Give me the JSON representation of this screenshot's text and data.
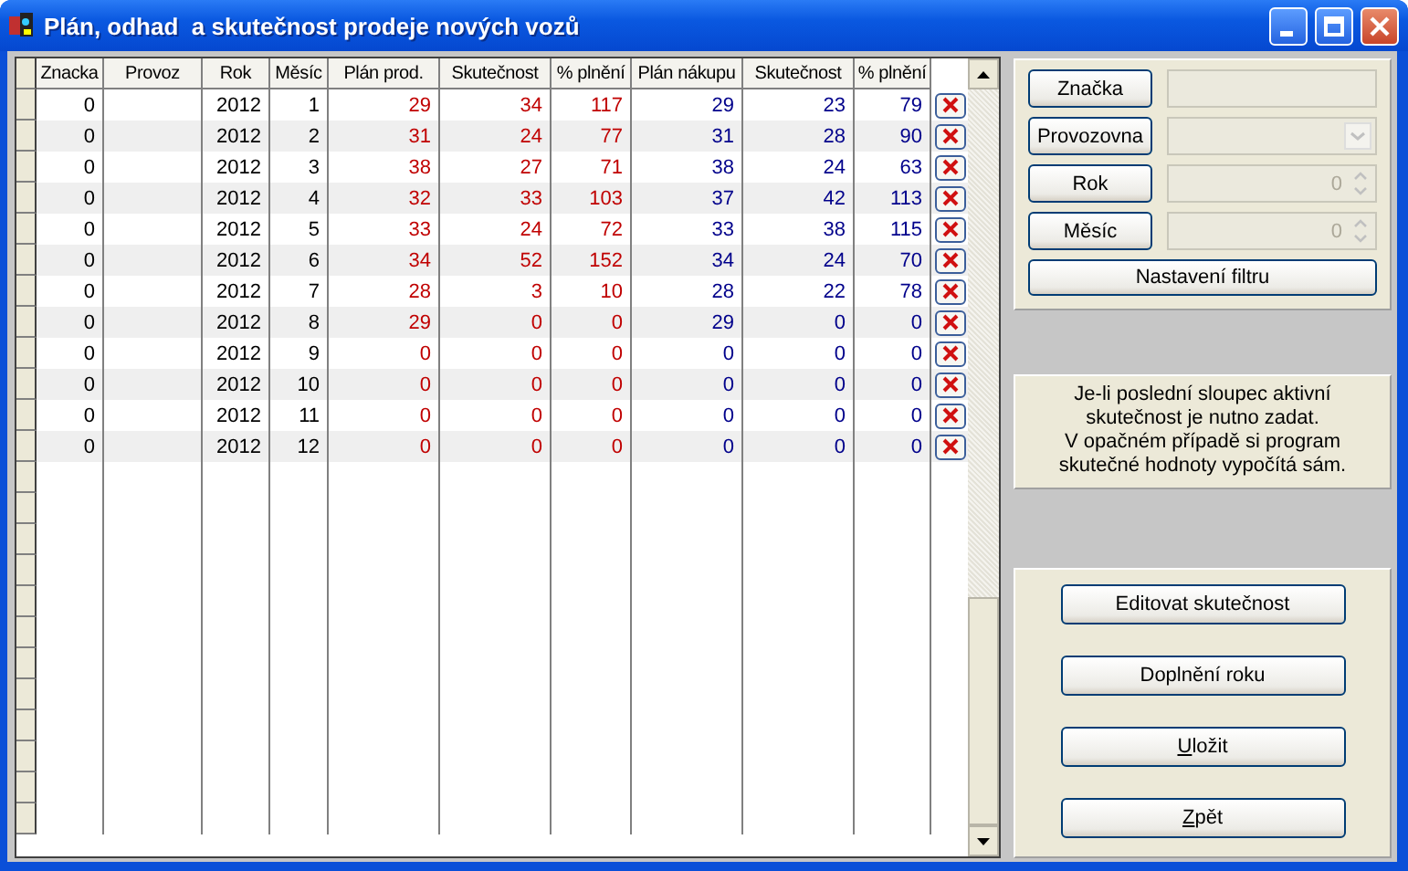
{
  "window": {
    "title": "Plán, odhad  a skutečnost prodeje nových vozů"
  },
  "table": {
    "columns": [
      {
        "label": "Znacka",
        "kind": "plain"
      },
      {
        "label": "Provoz",
        "kind": "plain"
      },
      {
        "label": "Rok",
        "kind": "plain"
      },
      {
        "label": "Měsíc",
        "kind": "plain"
      },
      {
        "label": "Plán prod.",
        "kind": "sales"
      },
      {
        "label": "Skutečnost",
        "kind": "sales"
      },
      {
        "label": "% plnění",
        "kind": "sales"
      },
      {
        "label": "Plán nákupu",
        "kind": "purchase"
      },
      {
        "label": "Skutečnost",
        "kind": "purchase"
      },
      {
        "label": "% plnění",
        "kind": "purchase"
      }
    ],
    "rows": [
      {
        "cells": [
          "0",
          "",
          "2012",
          "1",
          "29",
          "34",
          "117",
          "29",
          "23",
          "79"
        ]
      },
      {
        "cells": [
          "0",
          "",
          "2012",
          "2",
          "31",
          "24",
          "77",
          "31",
          "28",
          "90"
        ]
      },
      {
        "cells": [
          "0",
          "",
          "2012",
          "3",
          "38",
          "27",
          "71",
          "38",
          "24",
          "63"
        ]
      },
      {
        "cells": [
          "0",
          "",
          "2012",
          "4",
          "32",
          "33",
          "103",
          "37",
          "42",
          "113"
        ]
      },
      {
        "cells": [
          "0",
          "",
          "2012",
          "5",
          "33",
          "24",
          "72",
          "33",
          "38",
          "115"
        ]
      },
      {
        "cells": [
          "0",
          "",
          "2012",
          "6",
          "34",
          "52",
          "152",
          "34",
          "24",
          "70"
        ]
      },
      {
        "cells": [
          "0",
          "",
          "2012",
          "7",
          "28",
          "3",
          "10",
          "28",
          "22",
          "78"
        ]
      },
      {
        "cells": [
          "0",
          "",
          "2012",
          "8",
          "29",
          "0",
          "0",
          "29",
          "0",
          "0"
        ]
      },
      {
        "cells": [
          "0",
          "",
          "2012",
          "9",
          "0",
          "0",
          "0",
          "0",
          "0",
          "0"
        ]
      },
      {
        "cells": [
          "0",
          "",
          "2012",
          "10",
          "0",
          "0",
          "0",
          "0",
          "0",
          "0"
        ]
      },
      {
        "cells": [
          "0",
          "",
          "2012",
          "11",
          "0",
          "0",
          "0",
          "0",
          "0",
          "0"
        ]
      },
      {
        "cells": [
          "0",
          "",
          "2012",
          "12",
          "0",
          "0",
          "0",
          "0",
          "0",
          "0"
        ]
      }
    ]
  },
  "filter": {
    "fields": [
      {
        "label": "Značka",
        "kind": "text",
        "disabled": true
      },
      {
        "label": "Provozovna",
        "kind": "combo",
        "disabled": true
      },
      {
        "label": "Rok",
        "kind": "spin",
        "value": "0",
        "disabled": true
      },
      {
        "label": "Měsíc",
        "kind": "spin",
        "value": "0",
        "disabled": true
      }
    ],
    "apply_button": "Nastavení filtru"
  },
  "note": [
    "Je-li poslední sloupec aktivní",
    "skutečnost je nutno zadat.",
    "V opačném případě si program",
    "skutečné hodnoty vypočítá sám."
  ],
  "actions": [
    {
      "label": "Editovat skutečnost",
      "mnemonic": false
    },
    {
      "label": "Doplnění roku",
      "mnemonic": false
    },
    {
      "label": "Uložit",
      "mnemonic": true
    },
    {
      "label": "Zpět",
      "mnemonic": true
    }
  ]
}
